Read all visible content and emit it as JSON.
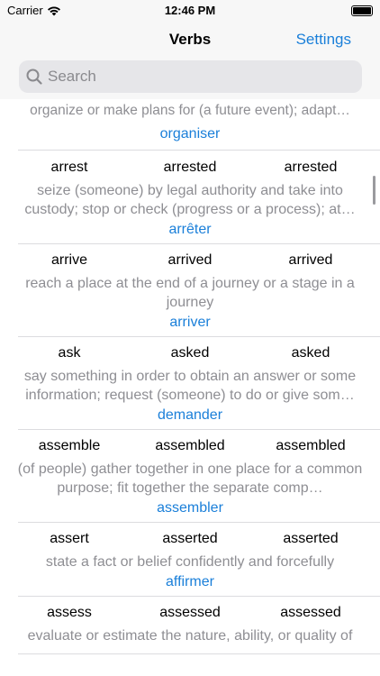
{
  "status_bar": {
    "carrier": "Carrier",
    "time": "12:46 PM"
  },
  "nav": {
    "title": "Verbs",
    "settings_label": "Settings"
  },
  "search": {
    "placeholder": "Search",
    "value": ""
  },
  "partial_row": {
    "definition": "organize or make plans for (a future event); adapt…",
    "translation": "organiser"
  },
  "verbs": [
    {
      "base": "arrest",
      "past": "arrested",
      "participle": "arrested",
      "definition": "seize (someone) by legal authority and take into custody; stop or check (progress or a process); at…",
      "translation": "arrêter"
    },
    {
      "base": "arrive",
      "past": "arrived",
      "participle": "arrived",
      "definition": "reach a place at the end of a journey or a stage in a journey",
      "translation": "arriver"
    },
    {
      "base": "ask",
      "past": "asked",
      "participle": "asked",
      "definition": "say something in order to obtain an answer or some information; request (someone) to do or give som…",
      "translation": "demander"
    },
    {
      "base": "assemble",
      "past": "assembled",
      "participle": "assembled",
      "definition": "(of people) gather together in one place for a common purpose; fit together the separate comp…",
      "translation": "assembler"
    },
    {
      "base": "assert",
      "past": "asserted",
      "participle": "asserted",
      "definition": "state a fact or belief confidently and forcefully",
      "translation": "affirmer"
    },
    {
      "base": "assess",
      "past": "assessed",
      "participle": "assessed",
      "definition": "evaluate or estimate the nature, ability, or quality of",
      "translation": ""
    }
  ]
}
